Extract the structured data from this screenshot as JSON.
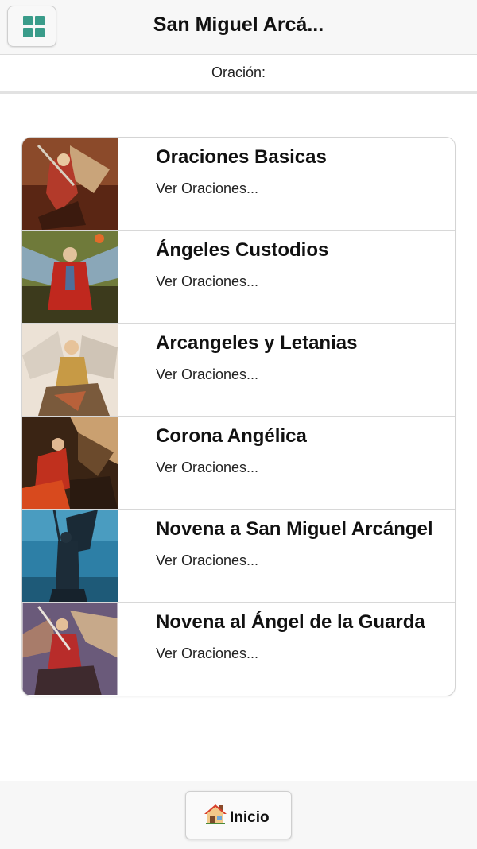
{
  "header": {
    "title": "San Miguel Arcá...",
    "menu_icon": "grid-icon"
  },
  "subheader": {
    "label": "Oración:"
  },
  "list": {
    "items": [
      {
        "title": "Oraciones Basicas",
        "subtitle": "Ver Oraciones..."
      },
      {
        "title": "Ángeles Custodios",
        "subtitle": "Ver Oraciones..."
      },
      {
        "title": "Arcangeles y Letanias",
        "subtitle": "Ver Oraciones..."
      },
      {
        "title": "Corona Angélica",
        "subtitle": "Ver Oraciones..."
      },
      {
        "title": "Novena a San Miguel Arcángel",
        "subtitle": "Ver Oraciones..."
      },
      {
        "title": "Novena al Ángel de la Guarda",
        "subtitle": "Ver Oraciones..."
      }
    ]
  },
  "footer": {
    "home_label": "Inicio",
    "home_icon": "house-icon"
  },
  "colors": {
    "accent": "#3a9c8a"
  }
}
